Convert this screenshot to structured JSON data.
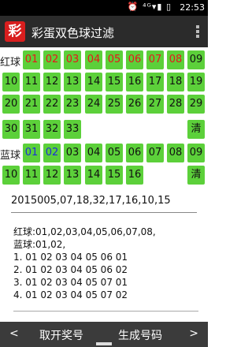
{
  "status_bar": {
    "icons": "⏰ ⁴ᴳ▾▮ ▯",
    "time": "22:53"
  },
  "app": {
    "logo_char": "彩",
    "title": "彩蛋双色球过滤",
    "menu_icon": "overflow-menu-icon"
  },
  "red": {
    "label": "红球",
    "row1": [
      "01",
      "02",
      "03",
      "04",
      "05",
      "06",
      "07",
      "08",
      "09"
    ],
    "row2": [
      "10",
      "11",
      "12",
      "13",
      "14",
      "15",
      "16",
      "17",
      "18",
      "19"
    ],
    "row3": [
      "20",
      "21",
      "22",
      "23",
      "24",
      "25",
      "26",
      "27",
      "28",
      "29"
    ],
    "row4": [
      "30",
      "31",
      "32",
      "33"
    ],
    "clear_label": "清"
  },
  "blue": {
    "label": "蓝球",
    "row1": [
      "01",
      "02",
      "03",
      "04",
      "05",
      "06",
      "07",
      "08",
      "09"
    ],
    "row2": [
      "10",
      "11",
      "12",
      "13",
      "14",
      "15",
      "16"
    ],
    "clear_label": "清"
  },
  "draw_input": {
    "value": "2015005,07,18,32,17,16,10,15"
  },
  "result": {
    "lines": [
      "红球:01,02,03,04,05,06,07,08,",
      "蓝球:01,02,",
      "1. 01 02 03 04 05 06  01",
      "2. 01 02 03 04 05 06  02",
      "3. 01 02 03 04 05 07  01",
      "4. 01 02 03 04 05 07  02"
    ]
  },
  "bottom_bar": {
    "prev": "<",
    "fetch_label": "取开奖号",
    "generate_label": "生成号码",
    "next": ">"
  }
}
